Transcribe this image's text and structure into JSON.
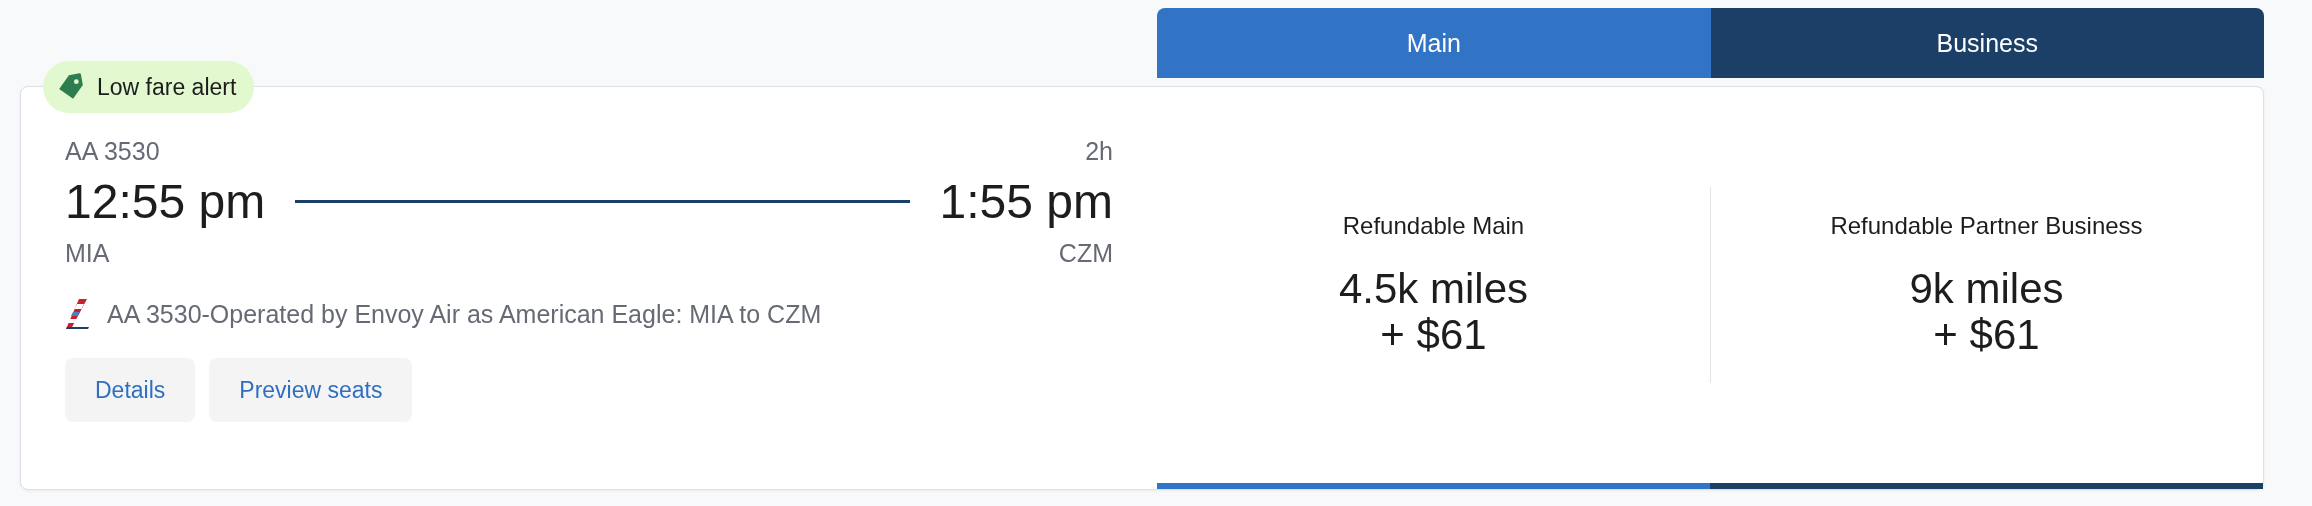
{
  "badge": {
    "label": "Low fare alert"
  },
  "flight": {
    "number": "AA 3530",
    "duration": "2h",
    "depart_time": "12:55 pm",
    "arrive_time": "1:55 pm",
    "origin": "MIA",
    "destination": "CZM",
    "operator": "AA 3530-Operated by Envoy Air as American Eagle: MIA to CZM"
  },
  "buttons": [
    "Details",
    "Preview seats"
  ],
  "cabins": [
    {
      "label": "Main",
      "color": "#3173c4",
      "fare": "Refundable Main",
      "miles": "4.5k miles",
      "price": "+ $61"
    },
    {
      "label": "Business",
      "color": "#1b3f66",
      "fare": "Refundable Partner Business",
      "miles": "9k miles",
      "price": "+ $61"
    }
  ]
}
